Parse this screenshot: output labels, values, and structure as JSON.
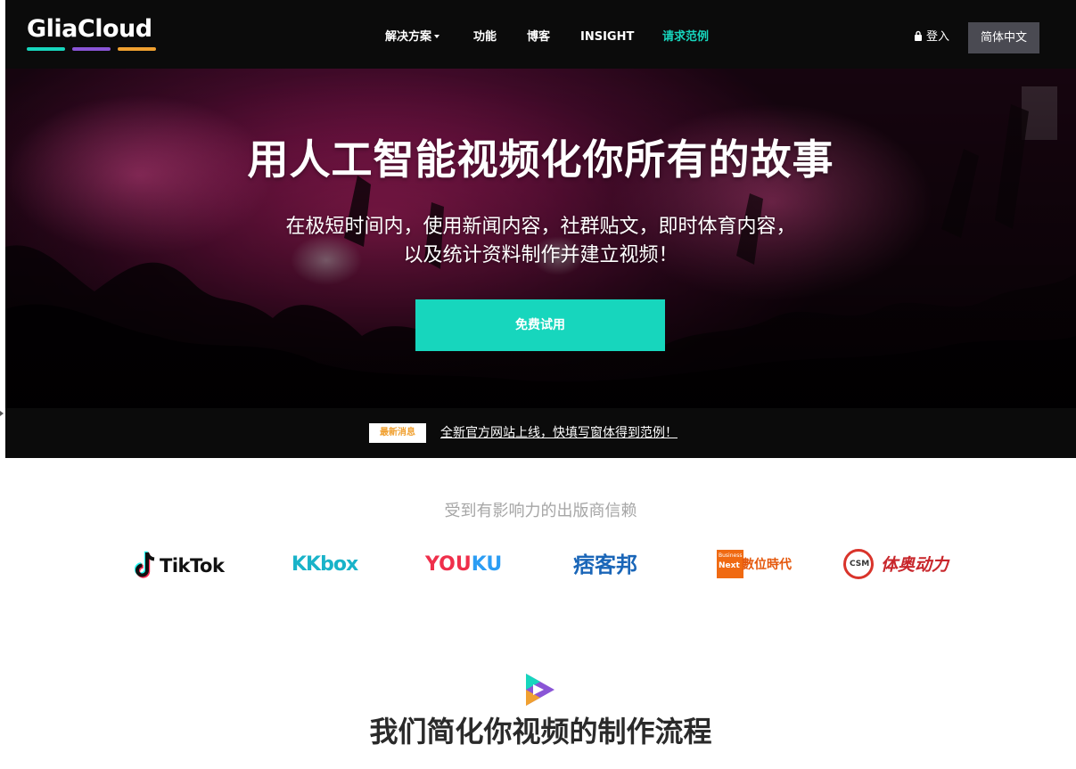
{
  "header": {
    "logo_text": "GliaCloud",
    "logo_bar_colors": [
      "#17d6bd",
      "#8a55d6",
      "#f0a030"
    ],
    "nav": [
      {
        "label": "解决方案",
        "has_dropdown": true
      },
      {
        "label": "功能"
      },
      {
        "label": "博客"
      },
      {
        "label": "INSIGHT"
      },
      {
        "label": "请求范例",
        "accent": true
      }
    ],
    "login_label": "登入",
    "login_icon": "lock-icon",
    "language_label": "简体中文"
  },
  "hero": {
    "title": "用人工智能视频化你所有的故事",
    "subtitle_line1": "在极短时间内，使用新闻内容，社群贴文，即时体育内容，",
    "subtitle_line2": "以及统计资料制作并建立视频！",
    "cta_label": "免费试用"
  },
  "news": {
    "badge": "最新消息",
    "link_text": "全新官方网站上线，快填写窗体得到范例！"
  },
  "trusted": {
    "title": "受到有影响力的出版商信赖",
    "logos": [
      {
        "name": "TikTok",
        "text": "TikTok"
      },
      {
        "name": "KKBOX",
        "text": "KKbox"
      },
      {
        "name": "Youku",
        "text_part1": "YOU",
        "text_part2": "KU"
      },
      {
        "name": "PIXNET",
        "text": "痞客邦"
      },
      {
        "name": "Business Next",
        "box_text_1": "Business",
        "box_text_2": "Next",
        "text": "數位時代"
      },
      {
        "name": "CSM",
        "badge": "CSM",
        "text": "体奥动力"
      }
    ]
  },
  "process": {
    "icon": "play-triangle-icon",
    "title": "我们简化你视频的制作流程"
  },
  "colors": {
    "accent": "#17d6bd",
    "header_bg": "#0b0b0b",
    "news_badge_text": "#f0a030"
  }
}
